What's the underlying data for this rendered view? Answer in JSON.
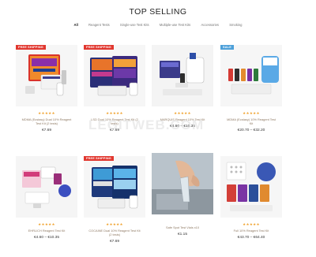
{
  "header": {
    "title": "TOP SELLING"
  },
  "filters": [
    "All",
    "Reagent Tests",
    "Single-use Test Kits",
    "Multiple-use Test Kits",
    "Accessories",
    "Smoking"
  ],
  "watermark": "LEGITWEB.COM",
  "products": [
    {
      "name": "MDMA (Ecstasy) Dual 10% Reagent Test Kit (2 tests)",
      "price": "€7.69",
      "badge": "FREE SHIPPING",
      "stars": "★★★★★"
    },
    {
      "name": "LSD Dual 10% Reagent Test Kit (2 tests)",
      "price": "€7.69",
      "badge": "FREE SHIPPING",
      "stars": "★★★★★"
    },
    {
      "name": "MARQUIS Reagent 10% Test Kit",
      "price": "€4.60 – €10.35",
      "badge": "",
      "stars": "★★★★★"
    },
    {
      "name": "MDMA (Ecstasy) 10% Reagent Test Kit",
      "price": "€20.70 – €32.20",
      "badge": "SALE",
      "stars": "★★★★★"
    },
    {
      "name": "EHRLICH Reagent Test Kit",
      "price": "€4.60 – €10.35",
      "badge": "",
      "stars": "★★★★★"
    },
    {
      "name": "COCAINE Dual 10% Reagent Test Kit (2 tests)",
      "price": "€7.69",
      "badge": "FREE SHIPPING",
      "stars": "★★★★★"
    },
    {
      "name": "Safe Spot Test Vials x10",
      "price": "€1.15",
      "badge": "",
      "stars": ""
    },
    {
      "name": "Full 10% Reagent Test Kit",
      "price": "€43.70 – €64.40",
      "badge": "",
      "stars": "★★★★★"
    }
  ]
}
